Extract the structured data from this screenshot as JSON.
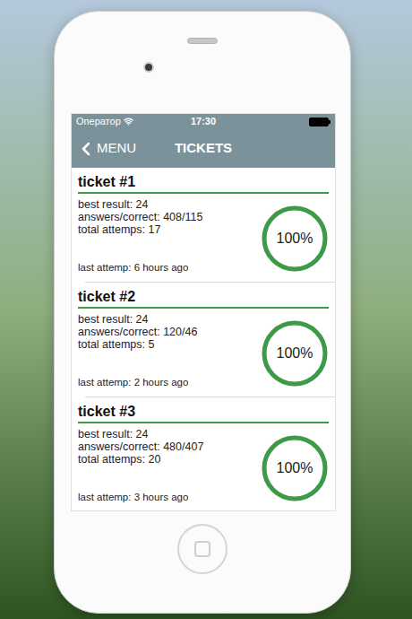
{
  "status_bar": {
    "carrier": "Оператор",
    "time": "17:30"
  },
  "nav_bar": {
    "back": "MENU",
    "title": "TICKETS"
  },
  "tickets": [
    {
      "title": "ticket #1",
      "best_result": "best result: 24",
      "answers": "answers/correct: 408/115",
      "attempts": "total attemps: 17",
      "last_attempt": "last attemp: 6 hours ago",
      "percent": "100%",
      "level": 1
    },
    {
      "title": "ticket #2",
      "best_result": "best result: 24",
      "answers": "answers/correct: 120/46",
      "attempts": "total attemps: 5",
      "last_attempt": "last attemp: 2 hours ago",
      "percent": "100%",
      "level": 1
    },
    {
      "title": "ticket #3",
      "best_result": "best result: 24",
      "answers": "answers/correct: 480/407",
      "attempts": "total attemps: 20",
      "last_attempt": "last attemp: 3 hours ago",
      "percent": "100%",
      "level": 1
    }
  ]
}
